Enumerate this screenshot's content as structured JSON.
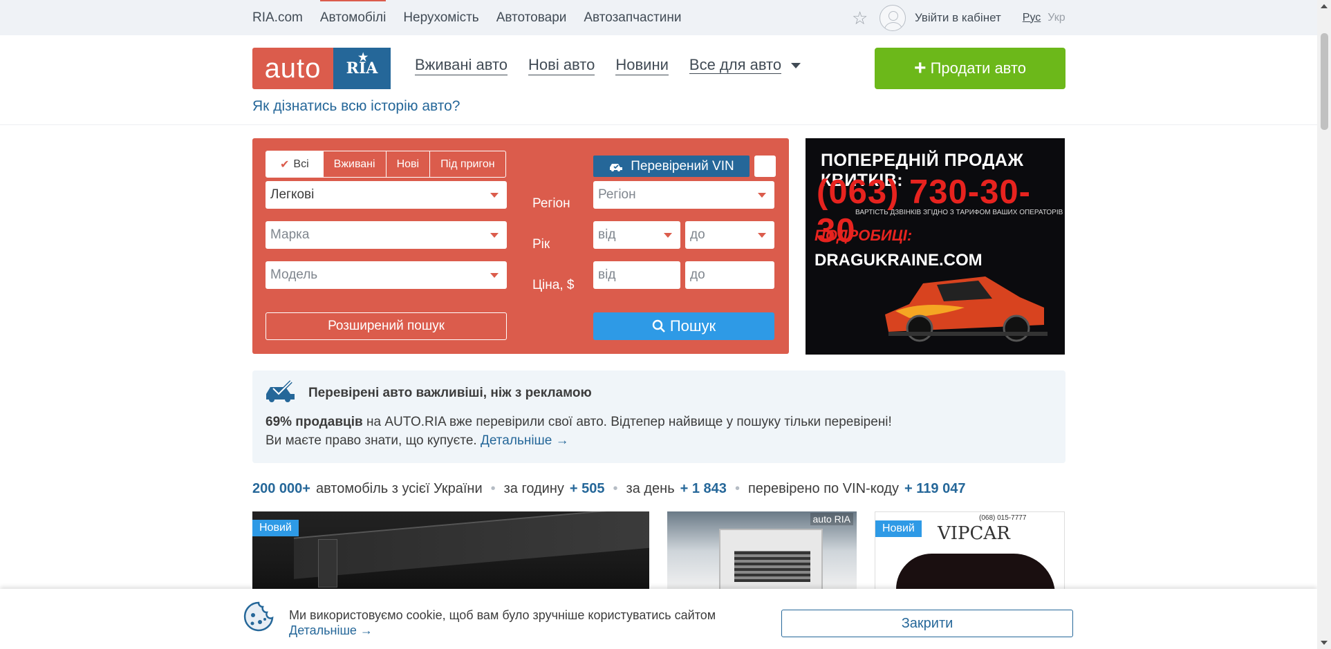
{
  "topnav": {
    "items": [
      "RIA.com",
      "Автомобілі",
      "Нерухомість",
      "Автотовари",
      "Автозапчастини"
    ],
    "login": "Увійти в кабінет",
    "lang_current": "Рус",
    "lang_other": "Укр"
  },
  "header": {
    "logo_left": "auto",
    "logo_right": "RIA",
    "nav": [
      "Вживані авто",
      "Нові авто",
      "Новини",
      "Все для авто"
    ],
    "sell_button": "Продати авто",
    "history_link": "Як дізнатись всю історію авто?"
  },
  "search": {
    "tabs": [
      "Всі",
      "Вживані",
      "Нові",
      "Під пригон"
    ],
    "vin_button": "Перевірений VIN",
    "type_value": "Легкові",
    "brand_placeholder": "Марка",
    "model_placeholder": "Модель",
    "region_label": "Регіон",
    "region_placeholder": "Регіон",
    "year_label": "Рік",
    "year_from": "від",
    "year_to": "до",
    "price_label": "Ціна, $",
    "price_from": "від",
    "price_to": "до",
    "extended": "Розширений пошук",
    "go": "Пошук"
  },
  "ad": {
    "line1": "ПОПЕРЕДНІЙ ПРОДАЖ КВИТКІВ:",
    "phone": "(063) 730-30-30",
    "note": "ВАРТІСТЬ ДЗВІНКІВ ЗГІДНО З ТАРИФОМ ВАШИХ ОПЕРАТОРІВ",
    "details": "ПОДРОБИЦІ:",
    "site": "DRAGUKRAINE.COM"
  },
  "info": {
    "title": "Перевірені авто важливіші, ніж з рекламою",
    "bold": "69% продавців",
    "line1_rest": " на AUTO.RIA вже перевірили свої авто. Відтепер найвище у пошуку тільки перевірені!",
    "line2": "Ви маєте право знати, що купуєте. ",
    "more": "Детальніше →"
  },
  "stats": {
    "total": "200 000+",
    "total_text": "автомобіль з усієї України",
    "hour_text": "за годину",
    "hour": "+ 505",
    "day_text": "за день",
    "day": "+ 1 843",
    "vin_text": "перевірено по VIN-коду",
    "vin": "+ 119 047"
  },
  "cards": {
    "badge": "Новий",
    "c2_watermark": "auto RIA",
    "c3_brand": "VIPCAR",
    "c3_phone": "(068) 015-7777"
  },
  "cookie": {
    "text": "Ми використовуємо cookie, щоб вам було зручніше користуватись сайтом",
    "more": "Детальніше →",
    "close": "Закрити"
  },
  "colors": {
    "brand_red": "#db5c4c",
    "brand_blue": "#256799",
    "sell_green": "#6cb81a",
    "search_blue": "#2e9ae6"
  }
}
